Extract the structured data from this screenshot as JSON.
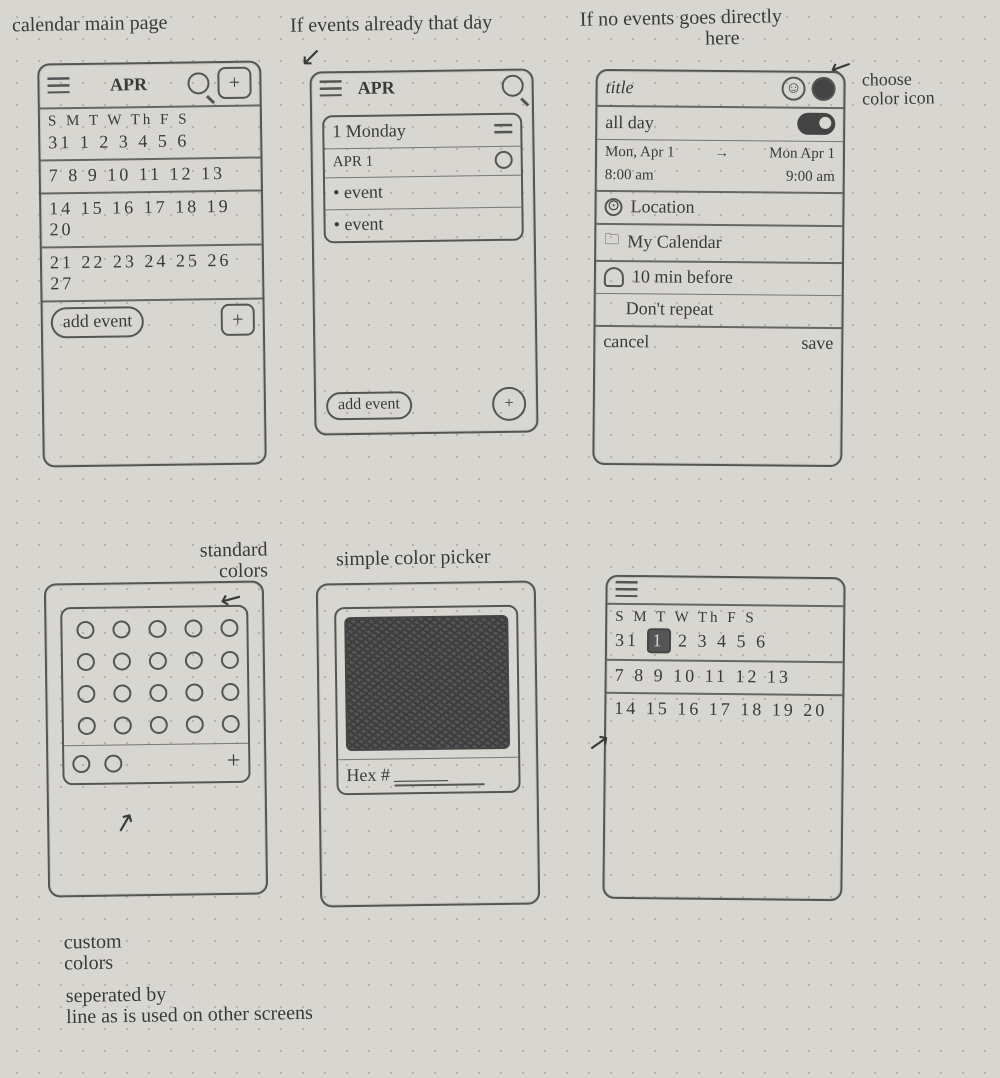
{
  "annotations": {
    "a1_main": "calendar main page",
    "a2_events": "If events already that day",
    "a3_noevents": "If no events goes directly\n                         here",
    "a3b_choose": "choose\ncolor icon",
    "a4_std": "standard\n   colors",
    "a5_simple": "simple color picker",
    "a6_custom": "custom\ncolors",
    "a7_sep": "seperated by\nline as is used on other screens"
  },
  "screen1": {
    "month": "APR",
    "weekdays": "S M T W Th F S",
    "row1": "31  1  2  3  4 5 6",
    "row2": " 7  8  9 10 11 12 13",
    "row3": "14 15 16 17 18 19 20",
    "row4": "21 22 23 24 25 26 27",
    "addEvent": "add event"
  },
  "screen2": {
    "month": "APR",
    "mag": "⌕",
    "dayHeader": "1 Monday",
    "sub": "APR 1",
    "event1": "• event",
    "event2": "• event",
    "addEvent": "add event"
  },
  "screen3": {
    "title": "title",
    "allDay": "all day",
    "startDate": "Mon, Apr 1",
    "endDate": "Mon Apr 1",
    "startTime": "8:00 am",
    "endTime": "9:00 am",
    "location": "Location",
    "calendar": "My Calendar",
    "reminder": "10 min before",
    "repeat": "Don't repeat",
    "cancel": "cancel",
    "save": "save"
  },
  "screen4": {
    "plus": "+"
  },
  "screen5": {
    "hexLabel": "Hex #",
    "hexPlaceholder": "______"
  },
  "screen6": {
    "weekdays": "S M T W Th F S",
    "row1": "31 1  2 3  4 5 6",
    "row2": " 7  8  9 10 11 12 13",
    "row3": "14 15 16 17 18 19 20"
  }
}
